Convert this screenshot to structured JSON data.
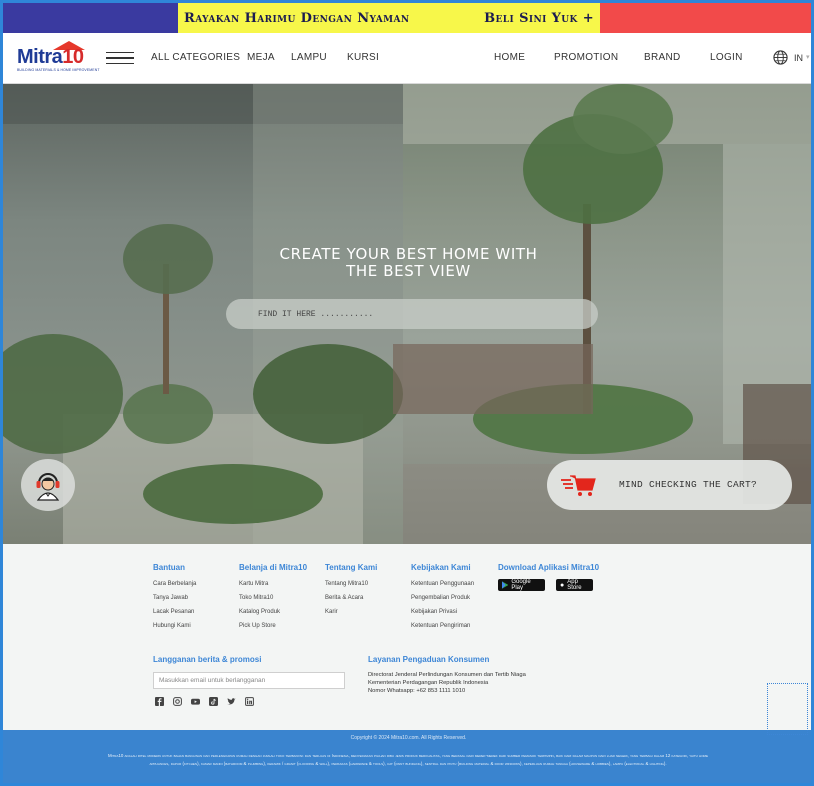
{
  "promo": {
    "left_text": "Rayakan Harimu Dengan Nyaman",
    "right_text": "Beli Sini Yuk +"
  },
  "brand": {
    "name_main": "Mitra",
    "name_num": "10",
    "tagline": "BUILDING MATERIALS & HOME IMPROVEMENT"
  },
  "nav": {
    "categories": [
      "ALL CATEGORIES",
      "MEJA",
      "LAMPU",
      "KURSI"
    ],
    "links": [
      "HOME",
      "PROMOTION",
      "BRAND",
      "LOGIN"
    ],
    "language": "IN"
  },
  "hero": {
    "title_line1": "CREATE YOUR BEST HOME WITH",
    "title_line2": "THE BEST VIEW",
    "search_placeholder": "FIND IT HERE ...........",
    "cart_text": "MIND CHECKING THE CART?"
  },
  "footer": {
    "columns": [
      {
        "title": "Bantuan",
        "items": [
          "Cara Berbelanja",
          "Tanya Jawab",
          "Lacak Pesanan",
          "Hubungi Kami"
        ]
      },
      {
        "title": "Belanja di Mitra10",
        "items": [
          "Kartu Mitra",
          "Toko Mitra10",
          "Katalog Produk",
          "Pick Up Store"
        ]
      },
      {
        "title": "Tentang Kami",
        "items": [
          "Tentang Mitra10",
          "Berita & Acara",
          "Karir"
        ]
      },
      {
        "title": "Kebijakan Kami",
        "items": [
          "Ketentuan Penggunaan",
          "Pengembalian Produk",
          "Kebijakan Privasi",
          "Ketentuan Pengiriman"
        ]
      }
    ],
    "app_title": "Download Aplikasi Mitra10",
    "google_play": "Google Play",
    "app_store": "App Store",
    "subscribe_title": "Langganan berita & promosi",
    "subscribe_placeholder": "Masukkan email untuk berlangganan",
    "complaint_title": "Layanan Pengaduan Konsumen",
    "complaint_lines": [
      "Directorat Jenderal Perlindungan Konsumen dan Tertib Niaga",
      "Kementerian Perdagangan Republik Indonesia",
      "Nomor Whatsapp:  +62 853 1111 1010"
    ],
    "socials": [
      "facebook-icon",
      "instagram-icon",
      "youtube-icon",
      "tiktok-icon",
      "twitter-icon",
      "linkedin-icon"
    ]
  },
  "bottom": {
    "copyright": "Copyright © 2024 Mitra10.com. All Rights Reserved.",
    "about": "Mitra10 adalah ritel modern untuk bahan bangunan dan perlengkapan rumah dengan jumlah toko terbanyak dan terluas di Indonesia, menyediakan pilihan ribu jenis produk berkualitas, yang berasal dari merek-merek dari sumber pemasok terpimpin, baik dari dalam maupun dari luar negeri, yang terbagi dalam 12 kategori, yaitu home appliances, dapur (kitchen), kamar mandi (bathroom & plumbing), keramik / granit (flooring & wall), perkakas (hardware & tools), cat (paint bundling), sentral dan pintu (building material & door windows), keperluan rumah tangga (houseware & hobbies), lampu (electrical & lighting)."
  },
  "colors": {
    "accent": "#3d86d6",
    "promo_blue": "#3a3aa0",
    "promo_yellow": "#f7f74a",
    "promo_red": "#f24a4a"
  }
}
